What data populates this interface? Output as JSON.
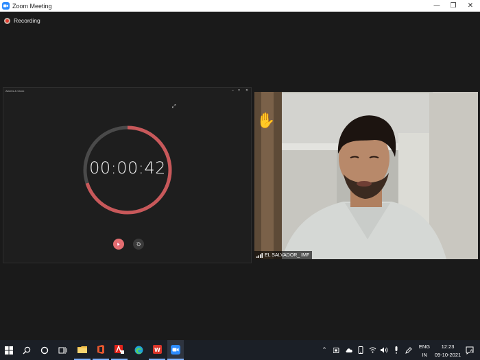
{
  "window": {
    "title": "Zoom Meeting",
    "min_label": "—",
    "max_label": "❐",
    "close_label": "✕"
  },
  "recording": {
    "label": "Recording"
  },
  "alarm_app": {
    "title": "Alarms & Clock",
    "elapsed": "00:00:42",
    "progress_fraction": 0.7,
    "accent": "#c8585a"
  },
  "participant": {
    "name": "EL SALVADOR_ IMF",
    "reaction": "raised-hand"
  },
  "taskbar": {
    "icons": [
      "windows-start-icon",
      "search-icon",
      "cortana-icon",
      "task-view-icon",
      "file-explorer-icon",
      "office-icon",
      "adobe-icon",
      "edge-icon",
      "wps-icon",
      "zoom-icon"
    ],
    "tray": {
      "lang_top": "ENG",
      "lang_bottom": "IN",
      "time": "12:23",
      "date": "09-10-2021",
      "notifications": "6"
    }
  }
}
